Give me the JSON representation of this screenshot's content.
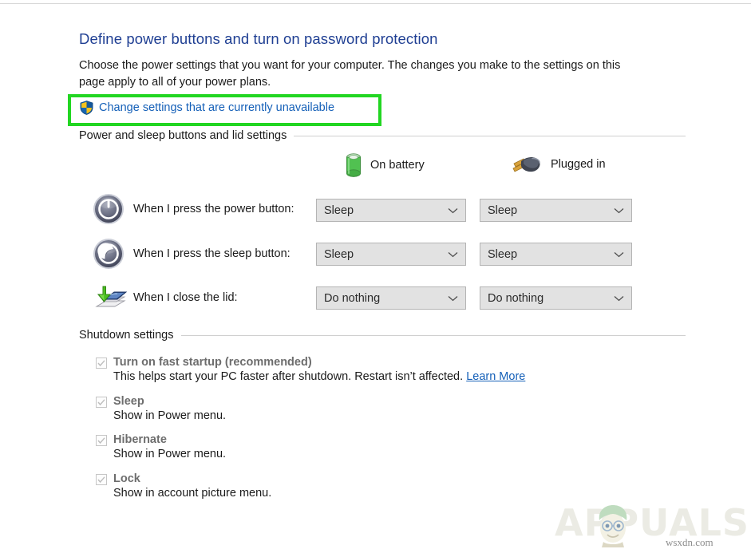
{
  "page": {
    "title": "Define power buttons and turn on password protection",
    "intro": "Choose the power settings that you want for your computer. The changes you make to the settings on this page apply to all of your power plans.",
    "uac_link": "Change settings that are currently unavailable"
  },
  "sections": {
    "power_lid": "Power and sleep buttons and lid settings",
    "shutdown": "Shutdown settings"
  },
  "columns": {
    "battery": "On battery",
    "plugged": "Plugged in"
  },
  "rows": [
    {
      "icon": "power-button-icon",
      "label": "When I press the power button:",
      "on_battery": "Sleep",
      "plugged_in": "Sleep"
    },
    {
      "icon": "sleep-button-icon",
      "label": "When I press the sleep button:",
      "on_battery": "Sleep",
      "plugged_in": "Sleep"
    },
    {
      "icon": "close-lid-icon",
      "label": "When I close the lid:",
      "on_battery": "Do nothing",
      "plugged_in": "Do nothing"
    }
  ],
  "shutdown_options": [
    {
      "title": "Turn on fast startup (recommended)",
      "desc_before": "This helps start your PC faster after shutdown. Restart isn’t affected. ",
      "link": "Learn More",
      "checked": true
    },
    {
      "title": "Sleep",
      "desc_before": "Show in Power menu.",
      "link": "",
      "checked": true
    },
    {
      "title": "Hibernate",
      "desc_before": "Show in Power menu.",
      "link": "",
      "checked": true
    },
    {
      "title": "Lock",
      "desc_before": "Show in account picture menu.",
      "link": "",
      "checked": true
    }
  ],
  "watermark": {
    "brand": "APPUALS",
    "source": "wsxdn.com"
  },
  "colors": {
    "heading": "#1f3f93",
    "link": "#1560b8",
    "highlight": "#22d622",
    "disabled_text": "#6d6d6d",
    "dropdown_fill": "#e2e2e2"
  }
}
